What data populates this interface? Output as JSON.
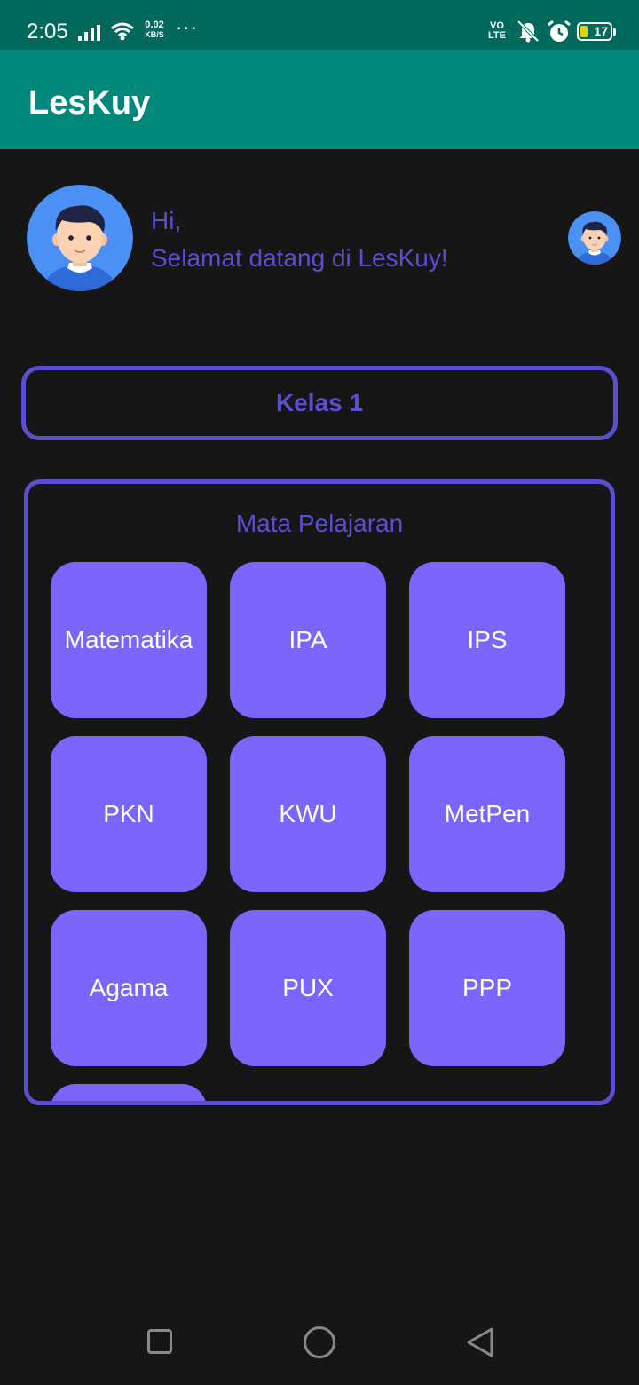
{
  "status_bar": {
    "time": "2:05",
    "net_speed_value": "0.02",
    "net_speed_unit": "KB/S",
    "overflow": "···",
    "volte_top": "VO",
    "volte_bottom": "LTE",
    "battery_level": "17"
  },
  "app_bar": {
    "title": "LesKuy"
  },
  "greeting": {
    "line1": "Hi,",
    "line2": "Selamat datang di LesKuy!"
  },
  "class_selector": {
    "label": "Kelas 1"
  },
  "subjects": {
    "title": "Mata Pelajaran",
    "items": [
      {
        "label": "Matematika"
      },
      {
        "label": "IPA"
      },
      {
        "label": "IPS"
      },
      {
        "label": "PKN"
      },
      {
        "label": "KWU"
      },
      {
        "label": "MetPen"
      },
      {
        "label": "Agama"
      },
      {
        "label": "PUX"
      },
      {
        "label": "PPP"
      },
      {
        "label": ""
      }
    ]
  },
  "colors": {
    "status_bar": "#00695c",
    "app_bar": "#00897b",
    "background": "#161616",
    "accent": "#5b4fd1",
    "tile": "#7b66fb",
    "avatar_bg": "#4a90f5"
  },
  "icons": {
    "signal": "signal-icon",
    "wifi": "wifi-icon",
    "mute": "mute-icon",
    "alarm": "alarm-icon",
    "battery": "battery-icon",
    "nav_recent": "recent-apps-icon",
    "nav_home": "home-icon",
    "nav_back": "back-icon"
  }
}
